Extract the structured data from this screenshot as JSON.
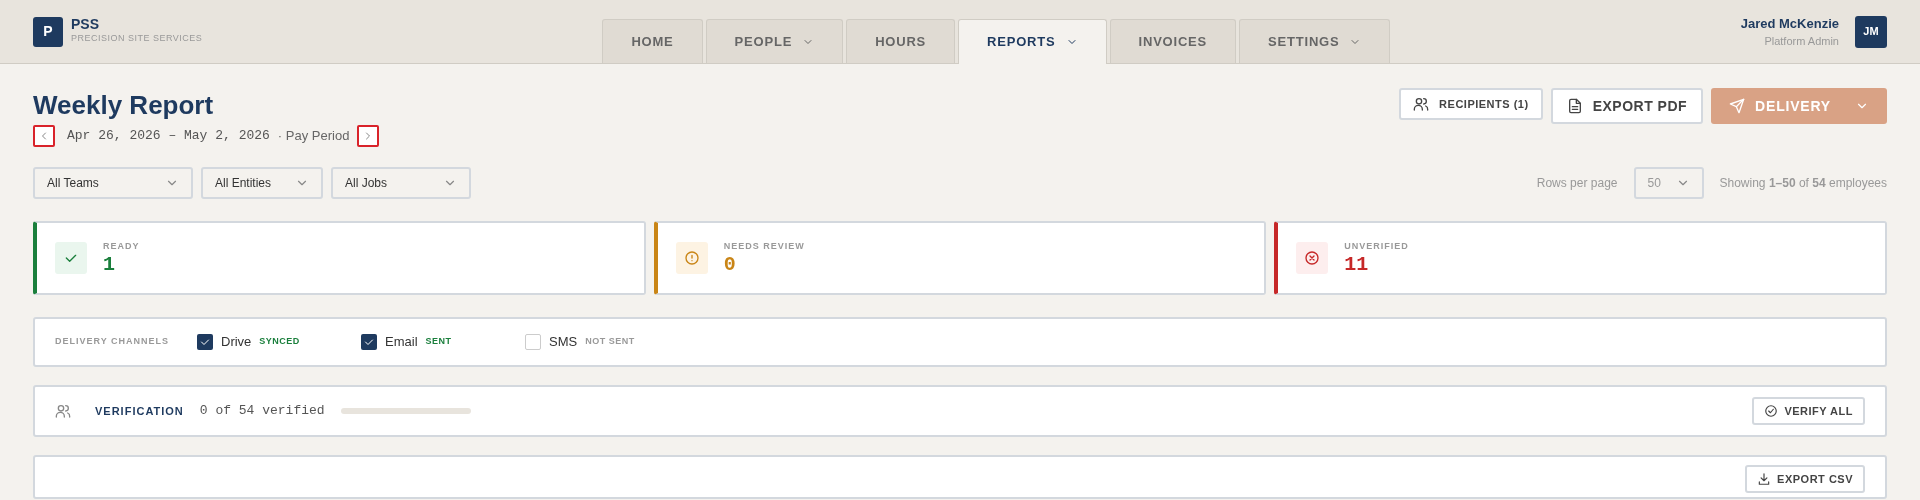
{
  "brand": {
    "logo": "P",
    "name": "PSS",
    "tagline": "PRECISION SITE SERVICES"
  },
  "tabs": [
    {
      "label": "HOME",
      "selected": false,
      "dropdown": false
    },
    {
      "label": "PEOPLE",
      "selected": false,
      "dropdown": true
    },
    {
      "label": "HOURS",
      "selected": false,
      "dropdown": false
    },
    {
      "label": "REPORTS",
      "selected": true,
      "dropdown": true
    },
    {
      "label": "INVOICES",
      "selected": false,
      "dropdown": false
    },
    {
      "label": "SETTINGS",
      "selected": false,
      "dropdown": true
    }
  ],
  "user": {
    "name": "Jared McKenzie",
    "role": "Platform Admin",
    "initials": "JM"
  },
  "page": {
    "title": "Weekly Report",
    "date_range": "Apr 26, 2026 – May 2, 2026",
    "period": "· Pay Period"
  },
  "actions": {
    "recipients": "RECIPIENTS (1)",
    "export_pdf": "EXPORT PDF",
    "delivery": "DELIVERY"
  },
  "filters": [
    {
      "value": "All Teams"
    },
    {
      "value": "All Entities"
    },
    {
      "value": "All Jobs"
    }
  ],
  "pagination": {
    "rows_label": "Rows per page",
    "rows_value": "50",
    "showing": "Showing **1–50** of **54** employees"
  },
  "stats": [
    {
      "kind": "ready",
      "label": "READY",
      "value": "1"
    },
    {
      "kind": "review",
      "label": "NEEDS REVIEW",
      "value": "0"
    },
    {
      "kind": "unverified",
      "label": "UNVERIFIED",
      "value": "11"
    }
  ],
  "delivery_channels": {
    "label": "DELIVERY CHANNELS",
    "channels": [
      {
        "name": "Drive",
        "status": "SYNCED",
        "checked": true
      },
      {
        "name": "Email",
        "status": "SENT",
        "checked": true
      },
      {
        "name": "SMS",
        "status": "NOT SENT",
        "checked": false
      }
    ]
  },
  "verification": {
    "label": "VERIFICATION",
    "count": "0 of 54 verified",
    "level": 0,
    "button": "VERIFY ALL"
  },
  "table_panel": {
    "button": "EXPORT CSV"
  }
}
